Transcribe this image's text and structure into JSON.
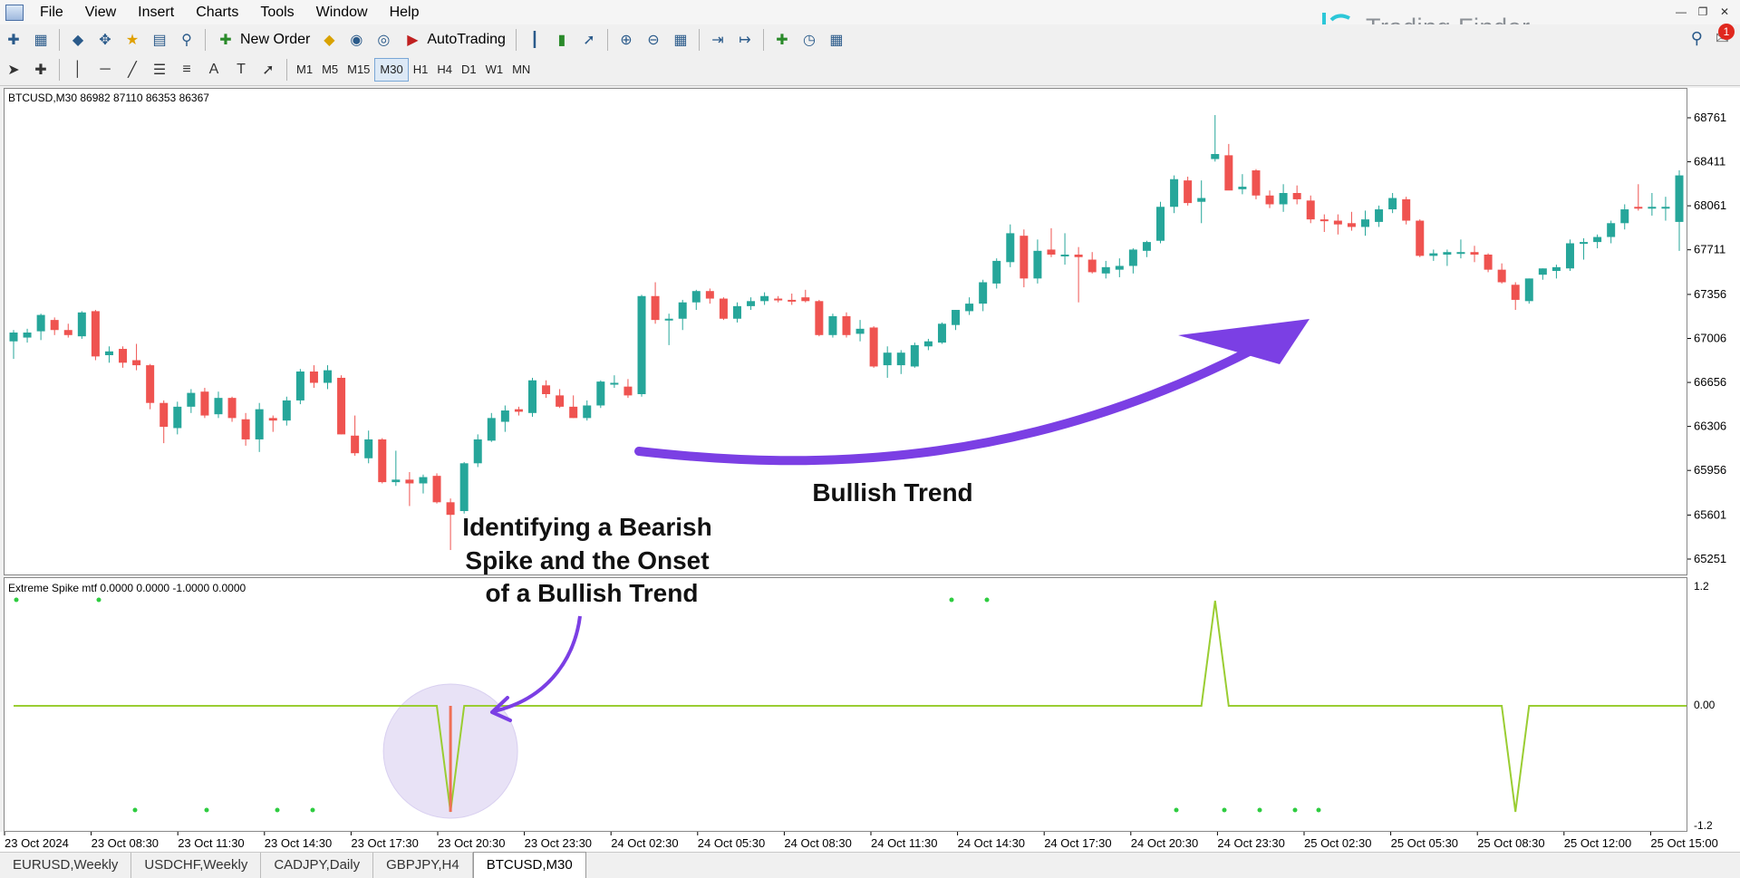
{
  "menu": [
    "File",
    "View",
    "Insert",
    "Charts",
    "Tools",
    "Window",
    "Help"
  ],
  "toolbar": {
    "new_order_label": "New Order",
    "autotrading_label": "AutoTrading",
    "timeframes": [
      "M1",
      "M5",
      "M15",
      "M30",
      "H1",
      "H4",
      "D1",
      "W1",
      "MN"
    ],
    "active_timeframe": "M30"
  },
  "logo": {
    "text": "Trading Finder",
    "color": "#2cc7d8"
  },
  "notifications": {
    "count": "1"
  },
  "chart": {
    "header": "BTCUSD,M30  86982 87110 86353 86367",
    "price_labels": [
      "68761",
      "68411",
      "68061",
      "67711",
      "67356",
      "67006",
      "66656",
      "66306",
      "65956",
      "65601",
      "65251"
    ],
    "bull_color": "#26a69a",
    "bear_color": "#ef5350"
  },
  "indicator": {
    "header": "Extreme Spike mtf 0.0000 0.0000 -1.0000 0.0000",
    "levels": [
      "1.2",
      "0.00",
      "-1.2"
    ],
    "line_color": "#9acd32"
  },
  "time_labels": [
    "23 Oct 2024",
    "23 Oct 08:30",
    "23 Oct 11:30",
    "23 Oct 14:30",
    "23 Oct 17:30",
    "23 Oct 20:30",
    "23 Oct 23:30",
    "24 Oct 02:30",
    "24 Oct 05:30",
    "24 Oct 08:30",
    "24 Oct 11:30",
    "24 Oct 14:30",
    "24 Oct 17:30",
    "24 Oct 20:30",
    "24 Oct 23:30",
    "25 Oct 02:30",
    "25 Oct 05:30",
    "25 Oct 08:30",
    "25 Oct 12:00",
    "25 Oct 15:00"
  ],
  "annotations": {
    "bullish_trend": "Bullish Trend",
    "bearish_spike_lines": [
      "Identifying a Bearish",
      "Spike and the Onset",
      "of a Bullish Trend"
    ],
    "arrow_color": "#7b3fe4"
  },
  "tabs": [
    "EURUSD,Weekly",
    "USDCHF,Weekly",
    "CADJPY,Daily",
    "GBPJPY,H4",
    "BTCUSD,M30"
  ],
  "active_tab": "BTCUSD,M30",
  "candles": [
    {
      "o": 66990,
      "h": 67080,
      "l": 66850,
      "c": 67060
    },
    {
      "o": 67020,
      "h": 67090,
      "l": 66980,
      "c": 67060
    },
    {
      "o": 67070,
      "h": 67210,
      "l": 67000,
      "c": 67200
    },
    {
      "o": 67160,
      "h": 67180,
      "l": 67040,
      "c": 67080
    },
    {
      "o": 67080,
      "h": 67130,
      "l": 67020,
      "c": 67040
    },
    {
      "o": 67030,
      "h": 67230,
      "l": 67010,
      "c": 67220
    },
    {
      "o": 67230,
      "h": 67240,
      "l": 66840,
      "c": 66870
    },
    {
      "o": 66880,
      "h": 66950,
      "l": 66820,
      "c": 66910
    },
    {
      "o": 66930,
      "h": 66950,
      "l": 66780,
      "c": 66820
    },
    {
      "o": 66840,
      "h": 66970,
      "l": 66760,
      "c": 66800
    },
    {
      "o": 66800,
      "h": 66810,
      "l": 66450,
      "c": 66500
    },
    {
      "o": 66500,
      "h": 66520,
      "l": 66180,
      "c": 66310
    },
    {
      "o": 66300,
      "h": 66510,
      "l": 66250,
      "c": 66470
    },
    {
      "o": 66470,
      "h": 66610,
      "l": 66420,
      "c": 66580
    },
    {
      "o": 66590,
      "h": 66620,
      "l": 66380,
      "c": 66400
    },
    {
      "o": 66410,
      "h": 66590,
      "l": 66380,
      "c": 66540
    },
    {
      "o": 66540,
      "h": 66550,
      "l": 66350,
      "c": 66380
    },
    {
      "o": 66370,
      "h": 66420,
      "l": 66160,
      "c": 66210
    },
    {
      "o": 66210,
      "h": 66500,
      "l": 66110,
      "c": 66450
    },
    {
      "o": 66380,
      "h": 66400,
      "l": 66270,
      "c": 66360
    },
    {
      "o": 66360,
      "h": 66550,
      "l": 66320,
      "c": 66520
    },
    {
      "o": 66520,
      "h": 66770,
      "l": 66490,
      "c": 66750
    },
    {
      "o": 66750,
      "h": 66800,
      "l": 66620,
      "c": 66660
    },
    {
      "o": 66660,
      "h": 66800,
      "l": 66610,
      "c": 66760
    },
    {
      "o": 66700,
      "h": 66720,
      "l": 66250,
      "c": 66250
    },
    {
      "o": 66240,
      "h": 66400,
      "l": 66080,
      "c": 66100
    },
    {
      "o": 66060,
      "h": 66280,
      "l": 66020,
      "c": 66210
    },
    {
      "o": 66210,
      "h": 66220,
      "l": 65860,
      "c": 65870
    },
    {
      "o": 65870,
      "h": 66120,
      "l": 65840,
      "c": 65890
    },
    {
      "o": 65890,
      "h": 65950,
      "l": 65680,
      "c": 65860
    },
    {
      "o": 65860,
      "h": 65930,
      "l": 65780,
      "c": 65910
    },
    {
      "o": 65920,
      "h": 65940,
      "l": 65700,
      "c": 65710
    },
    {
      "o": 65710,
      "h": 65740,
      "l": 65330,
      "c": 65610
    },
    {
      "o": 65640,
      "h": 66030,
      "l": 65620,
      "c": 66020
    },
    {
      "o": 66020,
      "h": 66250,
      "l": 65990,
      "c": 66210
    },
    {
      "o": 66200,
      "h": 66420,
      "l": 66190,
      "c": 66380
    },
    {
      "o": 66350,
      "h": 66480,
      "l": 66270,
      "c": 66440
    },
    {
      "o": 66450,
      "h": 66470,
      "l": 66400,
      "c": 66430
    },
    {
      "o": 66420,
      "h": 66700,
      "l": 66390,
      "c": 66680
    },
    {
      "o": 66640,
      "h": 66680,
      "l": 66540,
      "c": 66570
    },
    {
      "o": 66560,
      "h": 66610,
      "l": 66460,
      "c": 66470
    },
    {
      "o": 66470,
      "h": 66560,
      "l": 66380,
      "c": 66380
    },
    {
      "o": 66380,
      "h": 66520,
      "l": 66360,
      "c": 66480
    },
    {
      "o": 66480,
      "h": 66680,
      "l": 66460,
      "c": 66670
    },
    {
      "o": 66650,
      "h": 66720,
      "l": 66620,
      "c": 66660
    },
    {
      "o": 66630,
      "h": 66690,
      "l": 66540,
      "c": 66560
    },
    {
      "o": 66570,
      "h": 67360,
      "l": 66550,
      "c": 67350
    },
    {
      "o": 67350,
      "h": 67460,
      "l": 67130,
      "c": 67160
    },
    {
      "o": 67170,
      "h": 67210,
      "l": 66960,
      "c": 67170
    },
    {
      "o": 67170,
      "h": 67320,
      "l": 67080,
      "c": 67300
    },
    {
      "o": 67300,
      "h": 67400,
      "l": 67240,
      "c": 67390
    },
    {
      "o": 67390,
      "h": 67410,
      "l": 67290,
      "c": 67330
    },
    {
      "o": 67330,
      "h": 67340,
      "l": 67160,
      "c": 67170
    },
    {
      "o": 67170,
      "h": 67300,
      "l": 67140,
      "c": 67270
    },
    {
      "o": 67270,
      "h": 67340,
      "l": 67240,
      "c": 67310
    },
    {
      "o": 67310,
      "h": 67380,
      "l": 67280,
      "c": 67350
    },
    {
      "o": 67330,
      "h": 67350,
      "l": 67300,
      "c": 67320
    },
    {
      "o": 67320,
      "h": 67370,
      "l": 67280,
      "c": 67310
    },
    {
      "o": 67340,
      "h": 67400,
      "l": 67300,
      "c": 67310
    },
    {
      "o": 67310,
      "h": 67320,
      "l": 67030,
      "c": 67040
    },
    {
      "o": 67040,
      "h": 67210,
      "l": 67020,
      "c": 67190
    },
    {
      "o": 67190,
      "h": 67220,
      "l": 67020,
      "c": 67040
    },
    {
      "o": 67050,
      "h": 67160,
      "l": 66990,
      "c": 67090
    },
    {
      "o": 67100,
      "h": 67110,
      "l": 66780,
      "c": 66790
    },
    {
      "o": 66800,
      "h": 66950,
      "l": 66700,
      "c": 66900
    },
    {
      "o": 66800,
      "h": 66920,
      "l": 66730,
      "c": 66900
    },
    {
      "o": 66790,
      "h": 66980,
      "l": 66780,
      "c": 66960
    },
    {
      "o": 66950,
      "h": 67010,
      "l": 66920,
      "c": 66990
    },
    {
      "o": 66980,
      "h": 67140,
      "l": 66970,
      "c": 67130
    },
    {
      "o": 67120,
      "h": 67240,
      "l": 67080,
      "c": 67240
    },
    {
      "o": 67230,
      "h": 67340,
      "l": 67200,
      "c": 67290
    },
    {
      "o": 67290,
      "h": 67480,
      "l": 67230,
      "c": 67460
    },
    {
      "o": 67450,
      "h": 67650,
      "l": 67410,
      "c": 67630
    },
    {
      "o": 67620,
      "h": 67920,
      "l": 67580,
      "c": 67850
    },
    {
      "o": 67830,
      "h": 67880,
      "l": 67420,
      "c": 67490
    },
    {
      "o": 67490,
      "h": 67800,
      "l": 67450,
      "c": 67710
    },
    {
      "o": 67720,
      "h": 67890,
      "l": 67660,
      "c": 67680
    },
    {
      "o": 67680,
      "h": 67850,
      "l": 67600,
      "c": 67680
    },
    {
      "o": 67680,
      "h": 67740,
      "l": 67300,
      "c": 67660
    },
    {
      "o": 67640,
      "h": 67700,
      "l": 67530,
      "c": 67540
    },
    {
      "o": 67530,
      "h": 67630,
      "l": 67490,
      "c": 67580
    },
    {
      "o": 67560,
      "h": 67650,
      "l": 67500,
      "c": 67590
    },
    {
      "o": 67590,
      "h": 67730,
      "l": 67530,
      "c": 67720
    },
    {
      "o": 67710,
      "h": 67790,
      "l": 67660,
      "c": 67780
    },
    {
      "o": 67790,
      "h": 68100,
      "l": 67770,
      "c": 68060
    },
    {
      "o": 68060,
      "h": 68310,
      "l": 68010,
      "c": 68280
    },
    {
      "o": 68270,
      "h": 68300,
      "l": 68070,
      "c": 68090
    },
    {
      "o": 68100,
      "h": 68270,
      "l": 67930,
      "c": 68130
    },
    {
      "o": 68440,
      "h": 68790,
      "l": 68420,
      "c": 68480
    },
    {
      "o": 68470,
      "h": 68560,
      "l": 68210,
      "c": 68190
    },
    {
      "o": 68200,
      "h": 68320,
      "l": 68160,
      "c": 68220
    },
    {
      "o": 68350,
      "h": 68360,
      "l": 68120,
      "c": 68150
    },
    {
      "o": 68150,
      "h": 68190,
      "l": 68050,
      "c": 68080
    },
    {
      "o": 68080,
      "h": 68240,
      "l": 68020,
      "c": 68170
    },
    {
      "o": 68170,
      "h": 68230,
      "l": 68080,
      "c": 68120
    },
    {
      "o": 68110,
      "h": 68150,
      "l": 67930,
      "c": 67960
    },
    {
      "o": 67960,
      "h": 68000,
      "l": 67860,
      "c": 67950
    },
    {
      "o": 67950,
      "h": 68000,
      "l": 67840,
      "c": 67920
    },
    {
      "o": 67930,
      "h": 68020,
      "l": 67870,
      "c": 67900
    },
    {
      "o": 67900,
      "h": 68030,
      "l": 67830,
      "c": 67960
    },
    {
      "o": 67940,
      "h": 68070,
      "l": 67900,
      "c": 68040
    },
    {
      "o": 68040,
      "h": 68170,
      "l": 68010,
      "c": 68130
    },
    {
      "o": 68120,
      "h": 68140,
      "l": 67920,
      "c": 67950
    },
    {
      "o": 67950,
      "h": 67960,
      "l": 67660,
      "c": 67670
    },
    {
      "o": 67670,
      "h": 67720,
      "l": 67630,
      "c": 67690
    },
    {
      "o": 67680,
      "h": 67720,
      "l": 67590,
      "c": 67700
    },
    {
      "o": 67700,
      "h": 67800,
      "l": 67650,
      "c": 67700
    },
    {
      "o": 67700,
      "h": 67750,
      "l": 67620,
      "c": 67680
    },
    {
      "o": 67680,
      "h": 67690,
      "l": 67540,
      "c": 67560
    },
    {
      "o": 67560,
      "h": 67610,
      "l": 67450,
      "c": 67460
    },
    {
      "o": 67440,
      "h": 67460,
      "l": 67240,
      "c": 67320
    },
    {
      "o": 67310,
      "h": 67490,
      "l": 67290,
      "c": 67490
    },
    {
      "o": 67520,
      "h": 67570,
      "l": 67480,
      "c": 67570
    },
    {
      "o": 67550,
      "h": 67600,
      "l": 67490,
      "c": 67580
    },
    {
      "o": 67570,
      "h": 67800,
      "l": 67550,
      "c": 67770
    },
    {
      "o": 67770,
      "h": 67810,
      "l": 67640,
      "c": 67780
    },
    {
      "o": 67780,
      "h": 67840,
      "l": 67730,
      "c": 67820
    },
    {
      "o": 67820,
      "h": 67950,
      "l": 67770,
      "c": 67930
    },
    {
      "o": 67930,
      "h": 68080,
      "l": 67880,
      "c": 68040
    },
    {
      "o": 68060,
      "h": 68240,
      "l": 68030,
      "c": 68050
    },
    {
      "o": 68060,
      "h": 68170,
      "l": 67990,
      "c": 68060
    },
    {
      "o": 68060,
      "h": 68140,
      "l": 67950,
      "c": 68060
    },
    {
      "o": 67940,
      "h": 68350,
      "l": 67710,
      "c": 68310
    }
  ],
  "indicator_series": {
    "main": [
      0,
      0,
      0,
      0,
      0,
      0,
      0,
      0,
      0,
      0,
      0,
      0,
      0,
      0,
      0,
      0,
      0,
      0,
      0,
      0,
      0,
      0,
      0,
      0,
      0,
      0,
      0,
      0,
      0,
      0,
      0,
      0,
      -1,
      0,
      0,
      0,
      0,
      0,
      0,
      0,
      0,
      0,
      0,
      0,
      0,
      0,
      0,
      0,
      0,
      0,
      0,
      0,
      0,
      0,
      0,
      0,
      0,
      0,
      0,
      0,
      0,
      0,
      0,
      0,
      0,
      0,
      0,
      0,
      0,
      0,
      0,
      0,
      0,
      0,
      0,
      0,
      0,
      0,
      0,
      0,
      0,
      0,
      0,
      0,
      0,
      0,
      0,
      0,
      1,
      0,
      0,
      0,
      0,
      0,
      0,
      0,
      0,
      0,
      0,
      0,
      0,
      0,
      0,
      0,
      0,
      0,
      0,
      0,
      0,
      0,
      -1,
      0,
      0,
      0,
      0,
      0,
      0,
      0,
      0,
      0,
      0,
      0,
      0,
      0
    ]
  }
}
